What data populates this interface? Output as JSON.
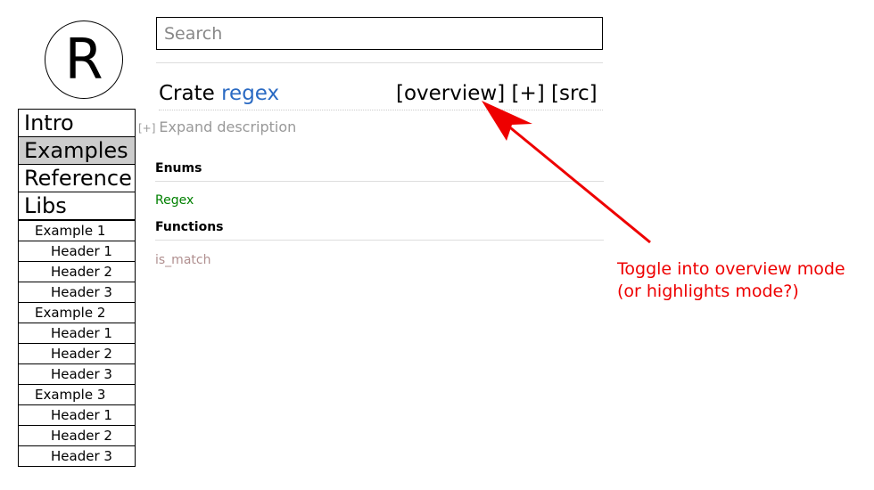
{
  "logo": {
    "letter": "R"
  },
  "search": {
    "placeholder": "Search"
  },
  "title": {
    "prefix": "Crate",
    "crate_name": "regex"
  },
  "actions": {
    "overview": "[overview]",
    "plus": "[+]",
    "src": "[src]"
  },
  "expand": {
    "toggle": "[+]",
    "label": "Expand description"
  },
  "sections": {
    "enums": {
      "heading": "Enums",
      "items": [
        "Regex"
      ]
    },
    "functions": {
      "heading": "Functions",
      "items": [
        "is_match"
      ]
    }
  },
  "sidebar": {
    "nav": [
      "Intro",
      "Examples",
      "Reference",
      "Libs"
    ],
    "active": "Examples",
    "examples": [
      {
        "label": "Example 1",
        "headers": [
          "Header 1",
          "Header 2",
          "Header 3"
        ]
      },
      {
        "label": "Example 2",
        "headers": [
          "Header 1",
          "Header 2",
          "Header 3"
        ]
      },
      {
        "label": "Example 3",
        "headers": [
          "Header 1",
          "Header 2",
          "Header 3"
        ]
      }
    ]
  },
  "annotation": {
    "line1": "Toggle into overview mode",
    "line2": "(or highlights mode?)"
  },
  "colors": {
    "crate_link": "#2a6ac3",
    "enum_link": "#008000",
    "fn_link": "#b08f8f",
    "annotation": "#ee0000",
    "active_nav_bg": "#cccccc"
  }
}
